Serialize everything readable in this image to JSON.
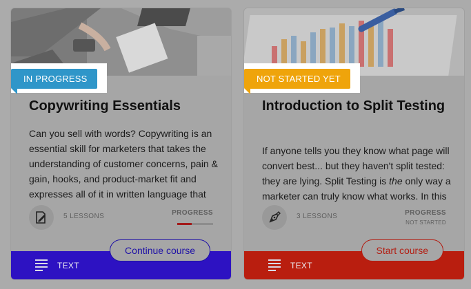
{
  "courses": [
    {
      "status": "IN PROGRESS",
      "status_color": "#2f96c9",
      "title": "Copywriting Essentials",
      "description": "Can you sell with words? Copywriting is an essential skill for marketers that takes the understanding of customer concerns, pain & gain, hooks, and product-market fit and expresses all of it in written language that",
      "icon": "pen-document-icon",
      "lessons": "5 LESSONS",
      "progress_label": "PROGRESS",
      "progress_sub": "",
      "progress": 0.4,
      "cta": "Continue course",
      "cta_color": "#1f12a6",
      "footer_label": "TEXT",
      "footer_color": "#2d12c2"
    },
    {
      "status": "NOT STARTED YET",
      "status_color": "#efa40b",
      "title": "Introduction to Split Testing",
      "description_parts": [
        "If anyone tells you they know what page will convert best... but they haven't split tested: they are lying. Split Testing is ",
        "the",
        " only way a marketer can truly know what works. In this"
      ],
      "icon": "fountain-pen-icon",
      "lessons": "3 LESSONS",
      "progress_label": "PROGRESS",
      "progress_sub": "NOT STARTED",
      "progress": 0,
      "cta": "Start course",
      "cta_color": "#b31d12",
      "footer_label": "TEXT",
      "footer_color": "#b91e0f"
    }
  ]
}
